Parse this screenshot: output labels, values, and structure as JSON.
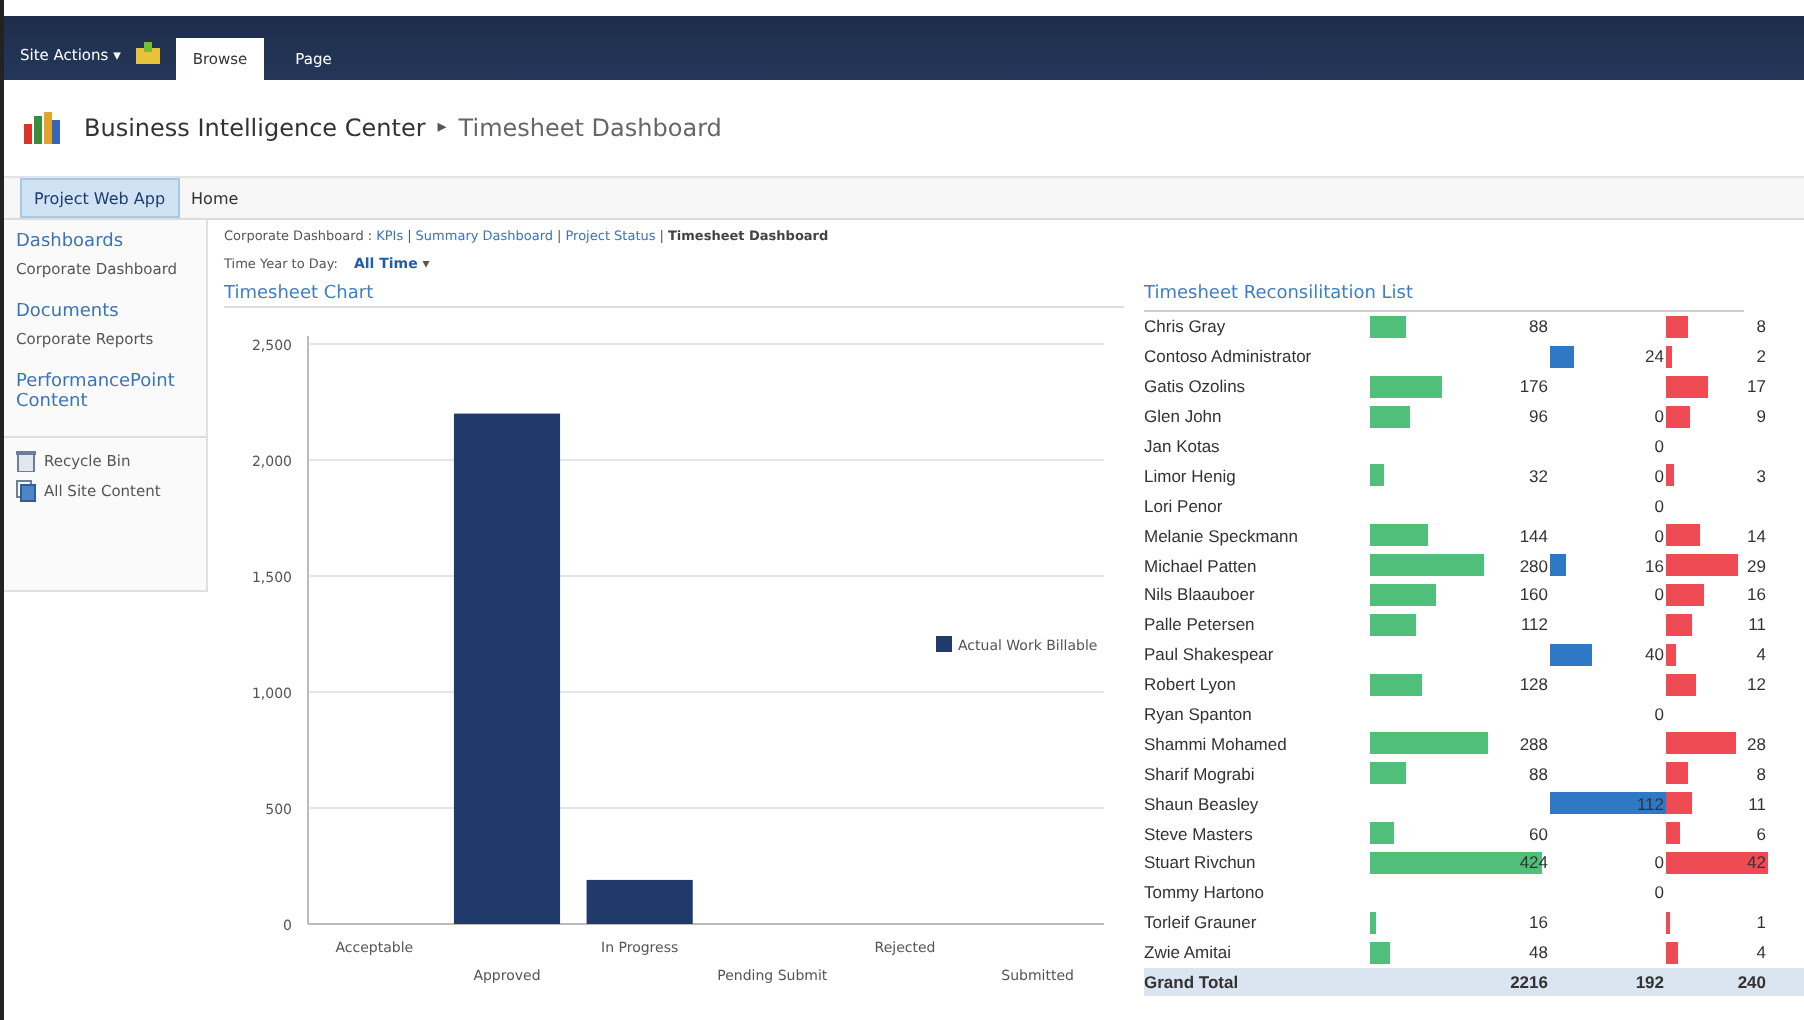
{
  "ribbon": {
    "site_actions": "Site Actions ▾",
    "tabs": [
      {
        "label": "Browse",
        "selected": true
      },
      {
        "label": "Page",
        "selected": false
      }
    ]
  },
  "header": {
    "site": "Business Intelligence Center",
    "separator": "▸",
    "page": "Timesheet Dashboard"
  },
  "top_nav": [
    {
      "label": "Project Web App",
      "selected": true
    },
    {
      "label": "Home",
      "selected": false
    }
  ],
  "sidebar": {
    "sections": [
      {
        "heading": "Dashboards",
        "items": [
          "Corporate Dashboard"
        ]
      },
      {
        "heading": "Documents",
        "items": [
          "Corporate Reports"
        ]
      },
      {
        "heading": "PerformancePoint Content"
      }
    ],
    "links": [
      {
        "label": "Recycle Bin",
        "kind": "bin"
      },
      {
        "label": "All Site Content",
        "kind": "content"
      }
    ]
  },
  "breadcrumb": {
    "prefix": "Corporate Dashboard :",
    "links": [
      "KPIs",
      "Summary Dashboard",
      "Project Status"
    ],
    "separator": "|",
    "current": "Timesheet Dashboard"
  },
  "filter": {
    "label": "Time Year to Day:",
    "value": "All Time",
    "caret": "▾"
  },
  "chart": {
    "title": "Timesheet Chart",
    "chart_data": {
      "type": "bar",
      "categories": [
        "Acceptable",
        "Approved",
        "In Progress",
        "Pending Submit",
        "Rejected",
        "Submitted"
      ],
      "series": [
        {
          "name": "Actual Work Billable",
          "color": "#1f3a6b",
          "values": [
            0,
            2200,
            190,
            0,
            0,
            0
          ]
        }
      ],
      "ylim": [
        0,
        2500
      ],
      "grid": true,
      "yticks": [
        {
          "value": 0,
          "label": "0"
        },
        {
          "value": 500,
          "label": "500"
        },
        {
          "value": 1000,
          "label": "1,000"
        },
        {
          "value": 1500,
          "label": "1,500"
        },
        {
          "value": 2000,
          "label": "2,000"
        },
        {
          "value": 2500,
          "label": "2,500"
        }
      ]
    }
  },
  "list": {
    "title": "Timesheet Reconsilitation List",
    "rows": [
      {
        "name": "Chris Gray",
        "column_2": "88",
        "column_4": "8"
      },
      {
        "name": "Contoso Administrator",
        "column_3": "24",
        "column_4": "2"
      },
      {
        "name": "Gatis Ozolins",
        "column_2": "176",
        "column_4": "17"
      },
      {
        "name": "Glen John",
        "column_2": "96",
        "column_3": "0",
        "column_4": "9"
      },
      {
        "name": "Jan Kotas",
        "column_3": "0"
      },
      {
        "name": "Limor Henig",
        "column_2": "32",
        "column_3": "0",
        "column_4": "3"
      },
      {
        "name": "Lori Penor",
        "column_3": "0"
      },
      {
        "name": "Melanie Speckmann",
        "column_2": "144",
        "column_3": "0",
        "column_4": "14"
      },
      {
        "name": "Michael Patten",
        "column_2": "280",
        "column_3": "16",
        "column_4": "29"
      },
      {
        "name": "Nils Blaauboer",
        "column_2": "160",
        "column_3": "0",
        "column_4": "16"
      },
      {
        "name": "Palle Petersen",
        "column_2": "112",
        "column_4": "11"
      },
      {
        "name": "Paul Shakespear",
        "column_3": "40",
        "column_4": "4"
      },
      {
        "name": "Robert Lyon",
        "column_2": "128",
        "column_4": "12"
      },
      {
        "name": "Ryan Spanton",
        "column_3": "0"
      },
      {
        "name": "Shammi Mohamed",
        "column_2": "288",
        "column_4": "28"
      },
      {
        "name": "Sharif Mograbi",
        "column_2": "88",
        "column_4": "8"
      },
      {
        "name": "Shaun Beasley",
        "column_3": "112",
        "column_4": "11"
      },
      {
        "name": "Steve Masters",
        "column_2": "60",
        "column_4": "6"
      },
      {
        "name": "Stuart Rivchun",
        "column_2": "424",
        "column_3": "0",
        "column_4": "42"
      },
      {
        "name": "Tommy Hartono",
        "column_3": "0"
      },
      {
        "name": "Torleif Grauner",
        "column_2": "16",
        "column_4": "1"
      },
      {
        "name": "Zwie Amitai",
        "column_2": "48",
        "column_4": "4"
      }
    ],
    "total": {
      "name": "Grand Total",
      "column_2": "2216",
      "column_3": "192",
      "column_4": "240"
    }
  }
}
